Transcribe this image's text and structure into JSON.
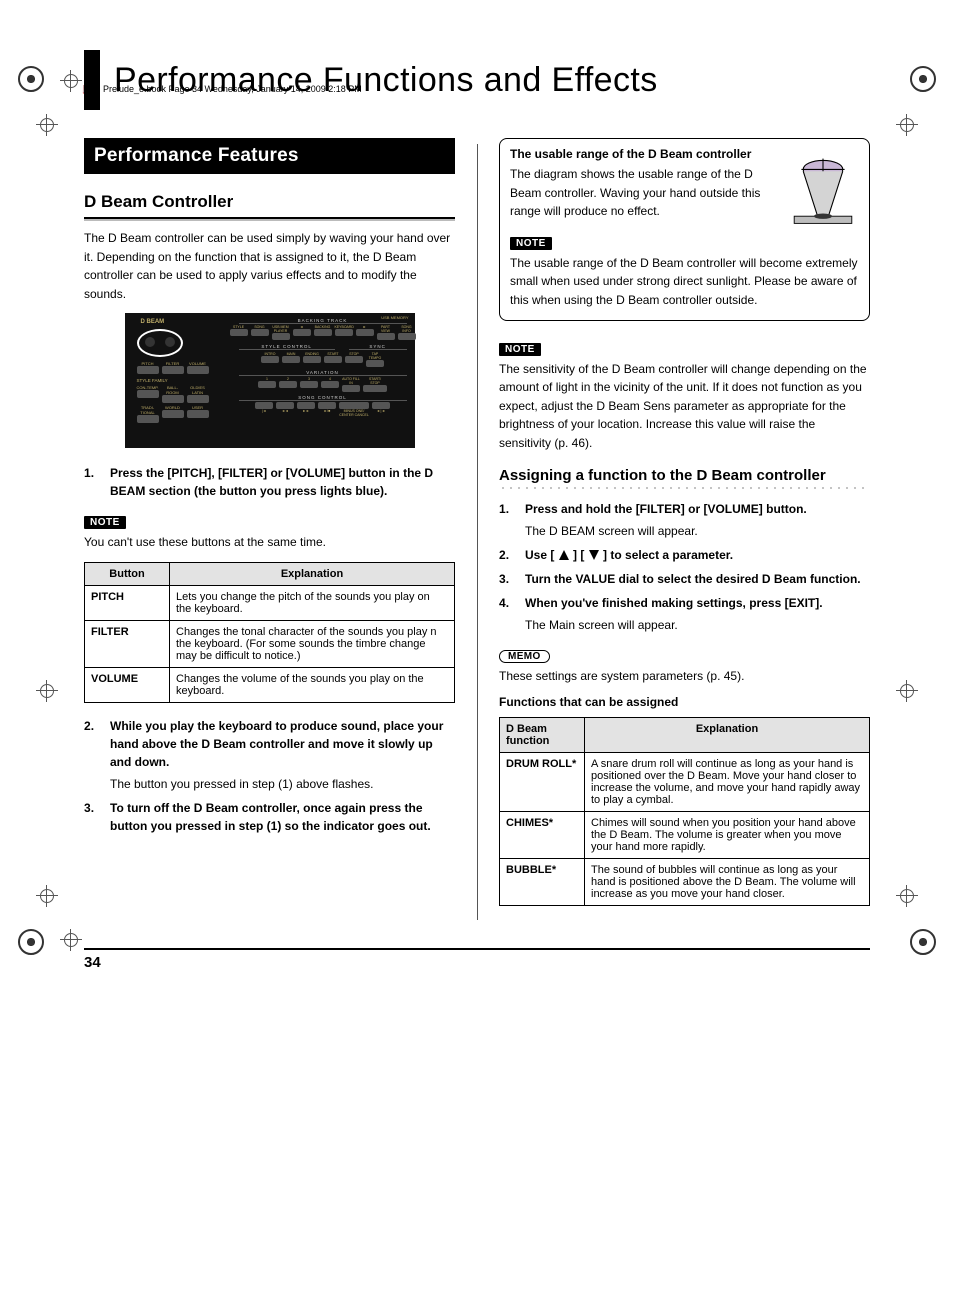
{
  "header": {
    "file_stamp": "Prelude_e.book  Page 34  Wednesday, January 14, 2009  2:18 PM"
  },
  "chapter_title": "Performance Functions and Effects",
  "left": {
    "section_banner": "Performance Features",
    "subheading": "D Beam Controller",
    "intro": "The D Beam controller can be used simply by waving your hand over it. Depending on the function that is assigned to it, the D Beam controller can be used to apply varius effects and to modify the sounds.",
    "panel": {
      "dbeam": "D BEAM",
      "pitch": "PITCH",
      "filter": "FILTER",
      "volume": "VOLUME",
      "style_family": "STYLE FAMILY",
      "sf": [
        "CON-TEMP.",
        "BALL-ROOM",
        "OLDIES LATIN",
        "TRADI-TIONAL",
        "WORLD",
        "USER"
      ],
      "usb": "USB MEMORY",
      "backing_track": "BACKING TRACK",
      "bt_sub1": "BACKING TYPE",
      "bt_sub2": "BALANCE",
      "bt_row1": [
        "STYLE",
        "SONG",
        "USB MEM PLAYER",
        "◄",
        "BACKING",
        "KEYBOARD",
        "►",
        "PART VIEW",
        "SONG INFO"
      ],
      "style_control": "STYLE CONTROL",
      "sync": "SYNC",
      "sc_row": [
        "INTRO",
        "MAIN",
        "ENDING",
        "START",
        "STOP",
        "TAP TEMPO"
      ],
      "variation": "VARIATION",
      "var_row": [
        "1",
        "2",
        "3",
        "4",
        "AUTO FILL IN",
        "START/ STOP"
      ],
      "song_control": "SONG CONTROL",
      "song_row": [
        "|◄",
        "◄◄",
        "►►",
        "►/■",
        "MINUS ONE/ CENTER CANCEL",
        "►|◄"
      ]
    },
    "steps_a": {
      "s1": "Press the [PITCH], [FILTER] or [VOLUME] button in the D BEAM section (the button you press lights blue).",
      "note_label": "NOTE",
      "note_text": "You can't use these buttons at the same time."
    },
    "table1": {
      "h1": "Button",
      "h2": "Explanation",
      "r1_label": "PITCH",
      "r1_text": "Lets you change the pitch of the sounds you play on the keyboard.",
      "r2_label": "FILTER",
      "r2_text": "Changes the tonal character of the sounds you play n the keyboard. (For some sounds the timbre change may be difficult to notice.)",
      "r3_label": "VOLUME",
      "r3_text": "Changes the volume of the sounds you play on the keyboard."
    },
    "steps_b": {
      "s2_bold": "While you play the keyboard to produce sound, place your hand above the D Beam controller and move it slowly up and down.",
      "s2_sub": "The button you pressed in step (1) above flashes.",
      "s3_bold": "To turn off the D Beam controller, once again press the button you pressed in step (1) so the indicator goes out."
    }
  },
  "right": {
    "box": {
      "title": "The usable range of the D Beam controller",
      "body": "The diagram shows the usable range of the D Beam controller. Waving your hand outside this range will produce no effect.",
      "note_label": "NOTE",
      "note_text": "The usable range of the D Beam controller will become extremely small when used under strong direct sunlight. Please be aware of this when using the D Beam controller outside."
    },
    "note2_label": "NOTE",
    "note2_text": "The sensitivity of the D Beam controller will change depending on the amount of light in the vicinity of the unit. If it does not function as you expect, adjust the D Beam Sens parameter as appropriate for the brightness of your location. Increase this value will raise the sensitivity (p. 46).",
    "assign_title": "Assigning a function to the D Beam controller",
    "assign_steps": {
      "s1_bold": "Press and hold the [FILTER] or [VOLUME] button.",
      "s1_sub": "The D BEAM screen will appear.",
      "s2_pre": "Use [",
      "s2_mid": "] [",
      "s2_post": "] to select a parameter.",
      "s3_bold": "Turn the VALUE dial to select the desired D Beam function.",
      "s4_bold": "When you've finished making settings, press [EXIT].",
      "s4_sub": "The Main screen will appear."
    },
    "memo_label": "MEMO",
    "memo_text": "These settings are system parameters (p. 45).",
    "func_title": "Functions that can be assigned",
    "table2": {
      "h1": "D Beam function",
      "h2": "Explanation",
      "r1_label": "DRUM ROLL*",
      "r1_text": "A snare drum roll will continue as long as your hand is positioned over the D Beam. Move your hand closer to increase the volume, and move your hand rapidly away to play a cymbal.",
      "r2_label": "CHIMES*",
      "r2_text": "Chimes will sound when you position your hand above the D Beam. The volume is greater when you move your hand more rapidly.",
      "r3_label": "BUBBLE*",
      "r3_text": "The sound of bubbles will continue as long as your hand is positioned above the D Beam. The volume will increase as you move your hand closer."
    }
  },
  "page_number": "34"
}
